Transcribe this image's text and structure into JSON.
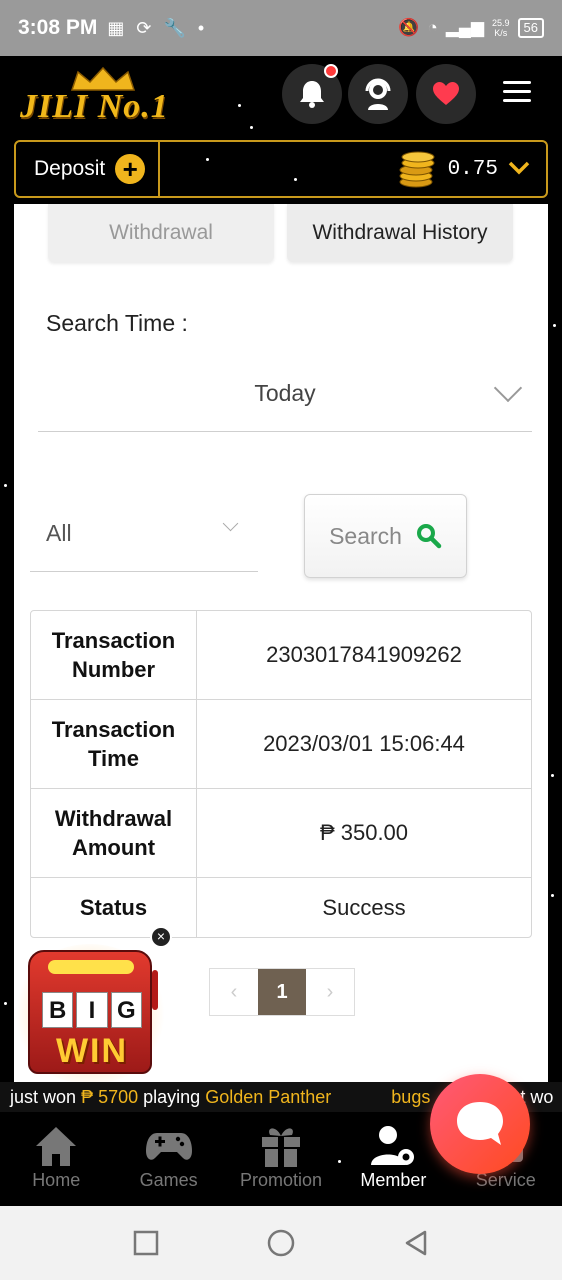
{
  "status_bar": {
    "time": "3:08 PM",
    "net_speed_value": "25.9",
    "net_speed_unit": "K/s",
    "battery": "56"
  },
  "header": {
    "logo_text": "JILI No.1"
  },
  "deposit_bar": {
    "deposit_label": "Deposit",
    "plus": "+",
    "balance": "0.75"
  },
  "tabs": {
    "withdrawal": "Withdrawal",
    "history": "Withdrawal History"
  },
  "filters": {
    "search_time_label": "Search Time :",
    "date_value": "Today",
    "type_value": "All",
    "search_label": "Search"
  },
  "details": [
    {
      "label": "Transaction Number",
      "value": "2303017841909262"
    },
    {
      "label": "Transaction Time",
      "value": "2023/03/01 15:06:44"
    },
    {
      "label": "Withdrawal Amount",
      "value": "₱ 350.00"
    },
    {
      "label": "Status",
      "value": "Success"
    }
  ],
  "pagination": {
    "prev": "‹",
    "current": "1",
    "next": "›"
  },
  "bigwin": {
    "reel1": "B",
    "reel2": "I",
    "reel3": "G",
    "win": "WIN",
    "close": "×"
  },
  "ticker": {
    "prefix": "just won",
    "amount": "₱ 5700",
    "middle": "playing",
    "game": "Golden Panther",
    "next_user": "bugs",
    "next_tail": "t wo"
  },
  "bottom_nav": {
    "items": [
      {
        "label": "Home",
        "icon": "home-icon"
      },
      {
        "label": "Games",
        "icon": "gamepad-icon"
      },
      {
        "label": "Promotion",
        "icon": "gift-icon"
      },
      {
        "label": "Member",
        "icon": "member-settings-icon"
      },
      {
        "label": "Service",
        "icon": "service-icon"
      }
    ]
  },
  "colors": {
    "gold": "#f0b51d",
    "pager_active": "#6f6151",
    "search_icon": "#1aa84a",
    "chat_fab": "#ff4a3f"
  }
}
